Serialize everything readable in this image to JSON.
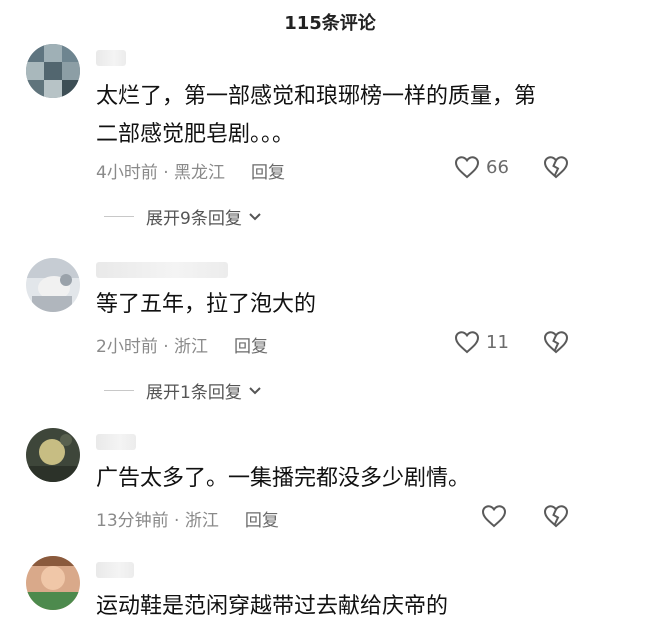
{
  "header": {
    "title": "115条评论"
  },
  "comments": [
    {
      "text_lines": [
        "太烂了，第一部感觉和琅琊榜一样的质量，第",
        "二部感觉肥皂剧。。。"
      ],
      "meta": "4小时前 · 黑龙江",
      "reply_label": "回复",
      "likes": "66",
      "expand_label": "展开9条回复",
      "avatar_icon": "user-avatar"
    },
    {
      "text_lines": [
        "等了五年，拉了泡大的"
      ],
      "meta": "2小时前 · 浙江",
      "reply_label": "回复",
      "likes": "11",
      "expand_label": "展开1条回复",
      "avatar_icon": "user-avatar"
    },
    {
      "text_lines": [
        "广告太多了。一集播完都没多少剧情。"
      ],
      "meta": "13分钟前 · 浙江",
      "reply_label": "回复",
      "likes": "",
      "avatar_icon": "user-avatar"
    },
    {
      "text_lines": [
        "运动鞋是范闲穿越带过去献给庆帝的"
      ],
      "avatar_icon": "user-avatar"
    }
  ],
  "icons": {
    "like": "heart-outline-icon",
    "dislike": "broken-heart-icon",
    "expand": "chevron-down-icon"
  },
  "colors": {
    "text": "#111111",
    "meta": "#8a8a8a",
    "icon": "#5a5a5a"
  }
}
